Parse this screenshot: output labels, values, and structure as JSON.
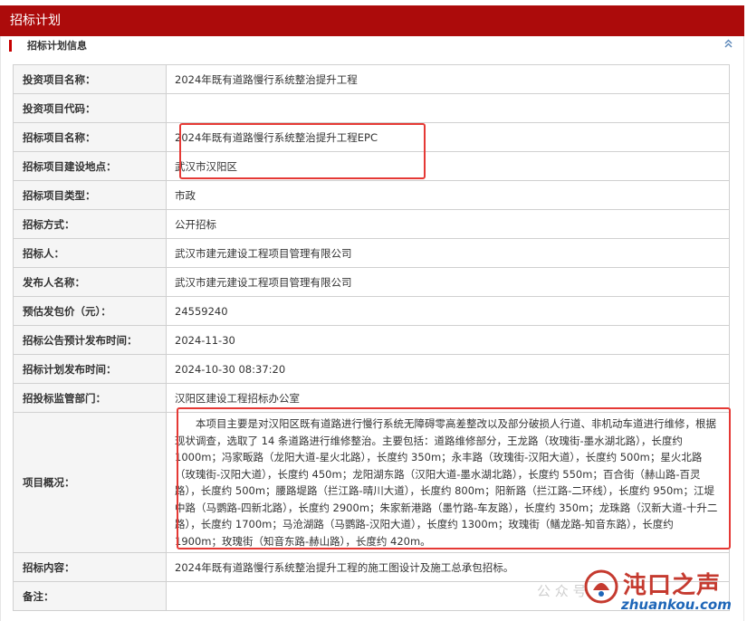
{
  "header": {
    "title": "招标计划"
  },
  "section": {
    "title": "招标计划信息",
    "collapse_icon": "chevron-up-double-icon"
  },
  "rows": [
    {
      "label": "投资项目名称：",
      "value": "2024年既有道路慢行系统整治提升工程"
    },
    {
      "label": "投资项目代码：",
      "value": ""
    },
    {
      "label": "招标项目名称：",
      "value": "2024年既有道路慢行系统整治提升工程EPC"
    },
    {
      "label": "招标项目建设地点：",
      "value": "武汉市汉阳区"
    },
    {
      "label": "招标项目类型：",
      "value": "市政"
    },
    {
      "label": "招标方式：",
      "value": "公开招标"
    },
    {
      "label": "招标人：",
      "value": "武汉市建元建设工程项目管理有限公司"
    },
    {
      "label": "发布人名称：",
      "value": "武汉市建元建设工程项目管理有限公司"
    },
    {
      "label": "预估发包价（元）：",
      "value": "24559240"
    },
    {
      "label": "招标公告预计发布时间：",
      "value": "2024-11-30"
    },
    {
      "label": "招标计划发布时间：",
      "value": "2024-10-30 08:37:20"
    },
    {
      "label": "招投标监管部门：",
      "value": "汉阳区建设工程招标办公室"
    },
    {
      "label": "项目概况：",
      "value": "本项目主要是对汉阳区既有道路进行慢行系统无障碍零高差整改以及部分破损人行道、非机动车道进行维修，根据现状调查，选取了 14 条道路进行维修整治。主要包括：道路维修部分，王龙路（玫瑰街-墨水湖北路），长度约 1000m；冯家畈路（龙阳大道-星火北路），长度约 350m；永丰路（玫瑰街-汉阳大道），长度约 500m；星火北路（玫瑰街-汉阳大道），长度约 450m；龙阳湖东路（汉阳大道-墨水湖北路），长度约 550m；百合街（赫山路-百灵路），长度约 500m；腰路堤路（拦江路-晴川大道），长度约 800m；阳新路（拦江路-二环线），长度约 950m；江堤中路（马鹦路-四新北路），长度约 2900m；朱家新港路（墨竹路-车友路），长度约 350m；龙珠路（汉新大道-十升二路），长度约 1700m；马沧湖路（马鹦路-汉阳大道），长度约 1300m；玫瑰街（鳝龙路-知音东路），长度约 1900m；玫瑰街（知音东路-赫山路），长度约 420m。"
    },
    {
      "label": "招标内容：",
      "value": "2024年既有道路慢行系统整治提升工程的施工图设计及施工总承包招标。"
    },
    {
      "label": "备注：",
      "value": ""
    }
  ],
  "watermark": {
    "brand": "沌口之声",
    "url": "zhuankou.com",
    "faint": "公 众 号",
    "logo_icon": "wechat-logo-icon"
  },
  "colors": {
    "header_bg": "#ac0b0b",
    "highlight_box": "#e53935",
    "label_bg": "#f5f5f5"
  }
}
